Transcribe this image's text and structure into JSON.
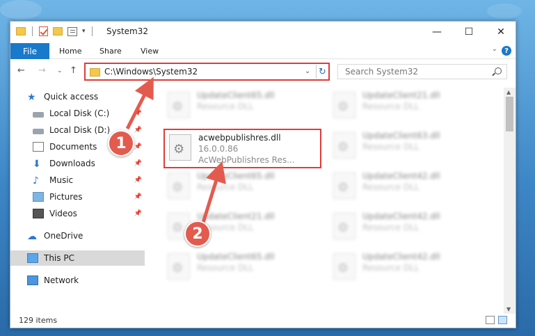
{
  "window": {
    "title": "System32"
  },
  "ribbon": {
    "tabs": [
      "File",
      "Home",
      "Share",
      "View"
    ]
  },
  "address": {
    "path": "C:\\Windows\\System32"
  },
  "search": {
    "placeholder": "Search System32"
  },
  "navpane": {
    "items": [
      {
        "label": "Quick access",
        "icon": "star-icon",
        "pinned": false
      },
      {
        "label": "Local Disk (C:)",
        "icon": "drive-icon",
        "pinned": true
      },
      {
        "label": "Local Disk (D:)",
        "icon": "drive-icon",
        "pinned": true
      },
      {
        "label": "Documents",
        "icon": "documents-icon",
        "pinned": true
      },
      {
        "label": "Downloads",
        "icon": "download-icon",
        "pinned": true
      },
      {
        "label": "Music",
        "icon": "music-icon",
        "pinned": true
      },
      {
        "label": "Pictures",
        "icon": "pictures-icon",
        "pinned": true
      },
      {
        "label": "Videos",
        "icon": "videos-icon",
        "pinned": true
      },
      {
        "label": "OneDrive",
        "icon": "cloud-icon",
        "pinned": false
      },
      {
        "label": "This PC",
        "icon": "computer-icon",
        "pinned": false,
        "selected": true
      },
      {
        "label": "Network",
        "icon": "network-icon",
        "pinned": false
      }
    ]
  },
  "files": {
    "highlighted": {
      "name": "acwebpublishres.dll",
      "version": "16.0.0.86",
      "description": "AcWebPublishres Res..."
    },
    "blurred": [
      {
        "name": "UpdateClient65.dll",
        "type": "Resource DLL"
      },
      {
        "name": "UpdateClient21.dll",
        "type": "Resource DLL"
      },
      {
        "name": "UpdateClient63.dll",
        "type": "Resource DLL"
      },
      {
        "name": "UpdateClient65.dll",
        "type": "Resource DLL"
      },
      {
        "name": "UpdateClient42.dll",
        "type": "Resource DLL"
      },
      {
        "name": "UpdateClient21.dll",
        "type": "Resource DLL"
      },
      {
        "name": "UpdateClient42.dll",
        "type": "Resource DLL"
      },
      {
        "name": "UpdateClient65.dll",
        "type": "Resource DLL"
      },
      {
        "name": "UpdateClient42.dll",
        "type": "Resource DLL"
      }
    ]
  },
  "status": {
    "item_count": "129 items"
  },
  "annotations": {
    "step1": "1",
    "step2": "2",
    "accent": "#e03b3b"
  }
}
